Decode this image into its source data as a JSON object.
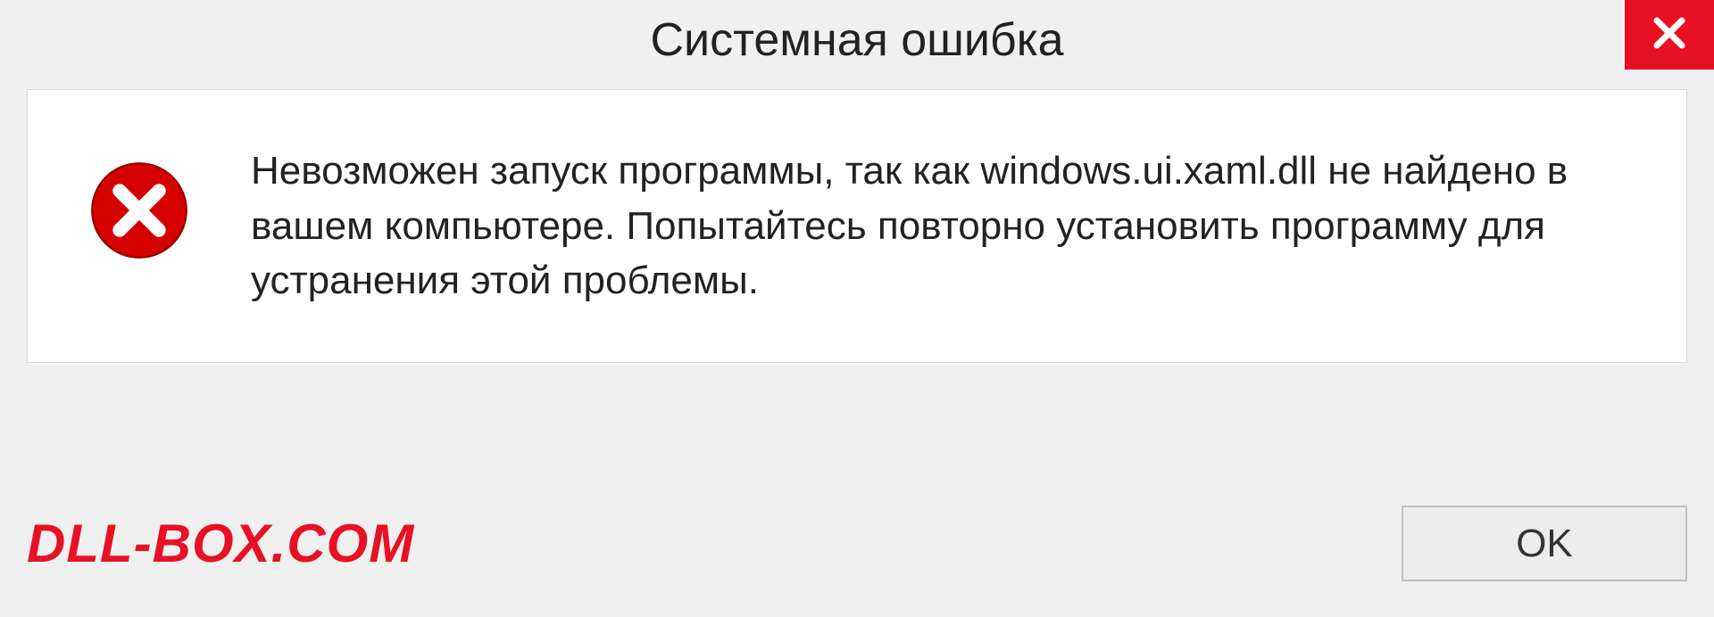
{
  "dialog": {
    "title": "Системная ошибка",
    "message": "Невозможен запуск программы, так как windows.ui.xaml.dll  не найдено в вашем компьютере. Попытайтесь повторно установить программу для устранения этой проблемы.",
    "ok_label": "OK"
  },
  "watermark": "DLL-BOX.COM",
  "colors": {
    "close_bg": "#e81123",
    "watermark": "#e81123",
    "error_icon_bg": "#d50000"
  }
}
